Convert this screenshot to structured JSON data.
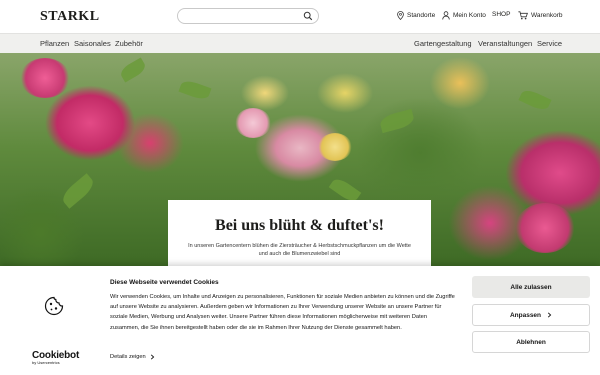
{
  "header": {
    "logo": "STARKL",
    "search": {
      "value": "",
      "placeholder": ""
    },
    "stores_label": "Standorte",
    "account_label": "Mein Konto",
    "shop_label": "SHOP",
    "cart_label": "Warenkorb"
  },
  "nav": {
    "left": [
      "Pflanzen",
      "Saisonales",
      "Zubehör"
    ],
    "right": [
      "Gartengestaltung",
      "Veranstaltungen",
      "Service"
    ]
  },
  "hero": {
    "title": "Bei uns blüht & duftet's!",
    "text": "In unseren Gartencentern blühen die Ziersträucher & Herbstschmuckpflanzen um die Wette und auch die Blumenzwiebel sind"
  },
  "cookie_banner": {
    "title": "Diese Webseite verwendet Cookies",
    "description": "Wir verwenden Cookies, um Inhalte und Anzeigen zu personalisieren, Funktionen für soziale Medien anbieten zu können und die Zugriffe auf unsere Website zu analysieren. Außerdem geben wir Informationen zu Ihrer Verwendung unserer Website an unsere Partner für soziale Medien, Werbung und Analysen weiter. Unsere Partner führen diese Informationen möglicherweise mit weiteren Daten zusammen, die Sie ihnen bereitgestellt haben oder die sie im Rahmen Ihrer Nutzung der Dienste gesammelt haben.",
    "details_label": "Details zeigen",
    "allow_label": "Alle zulassen",
    "customize_label": "Anpassen",
    "deny_label": "Ablehnen",
    "brand": "Cookiebot",
    "brand_sub": "by Usercentrics"
  },
  "colors": {
    "nav_bg": "#f0f0ee",
    "allow_bg": "#e9e9e7",
    "text": "#1d1d1b"
  }
}
